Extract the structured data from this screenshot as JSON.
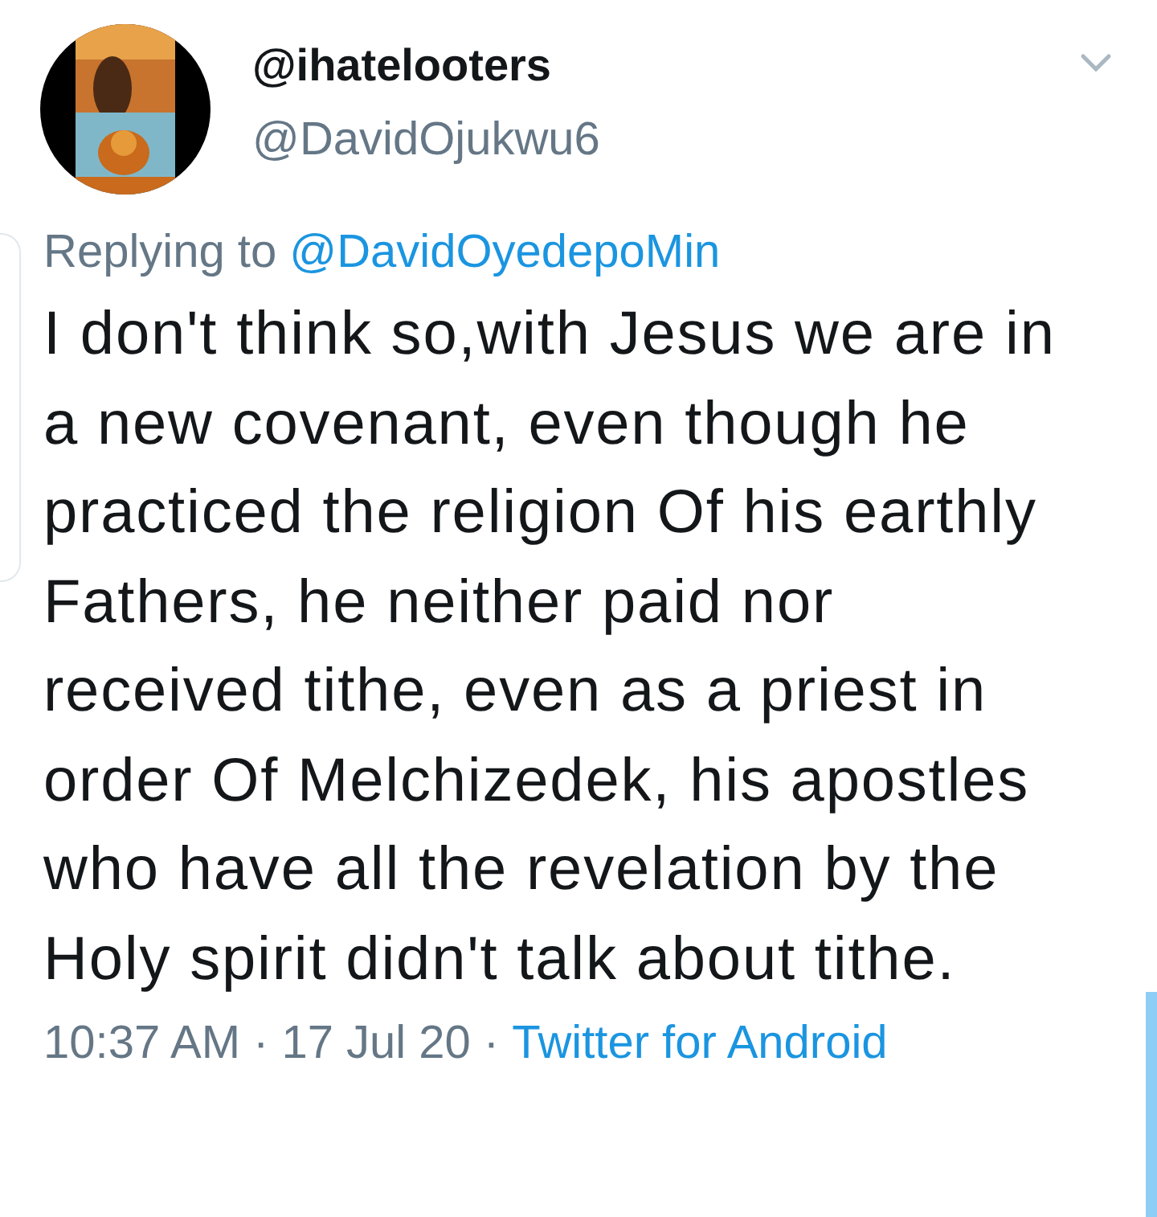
{
  "tweet": {
    "display_name": "@ihatelooters",
    "handle": "@DavidOjukwu6",
    "replying_label": "Replying to",
    "replying_to": "@DavidOyedepoMin",
    "text": "I don't think so,with Jesus we are in a new covenant, even though he practiced the religion Of his earthly Fathers, he neither paid nor received tithe, even as a priest in order Of Melchizedek, his apostles who have all the revelation by the Holy spirit didn't talk about tithe.",
    "time": "10:37 AM",
    "date": "17 Jul 20",
    "separator": "·",
    "source": "Twitter for Android"
  }
}
